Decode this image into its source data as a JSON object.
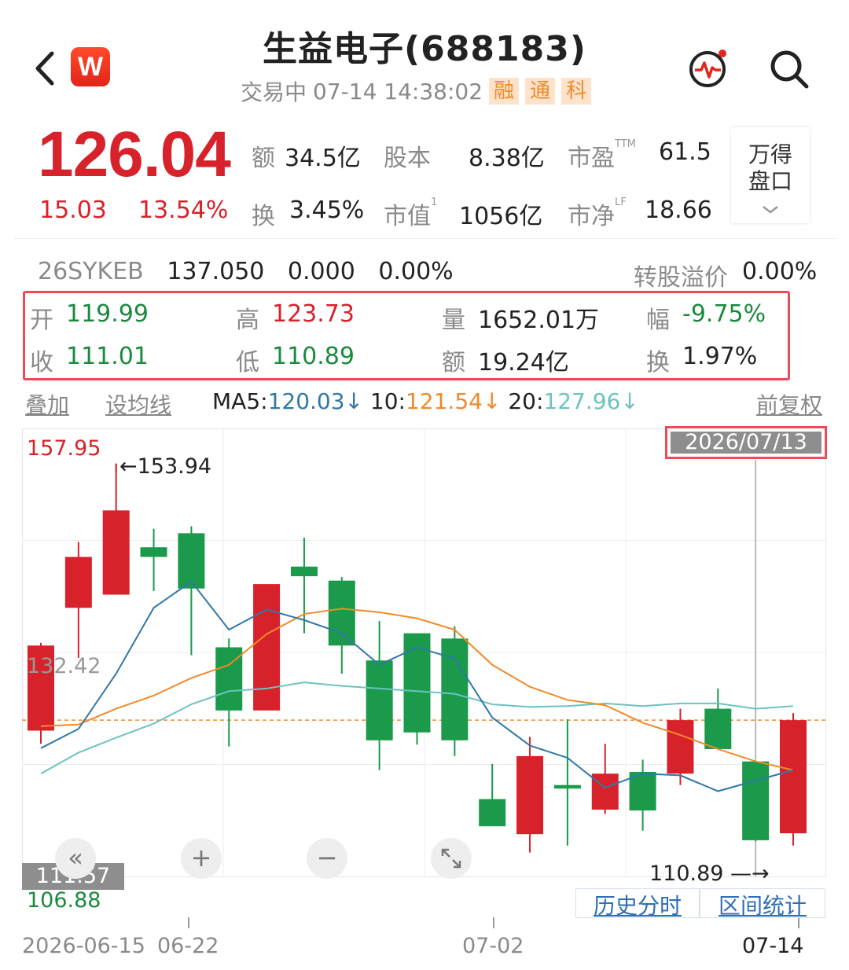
{
  "header": {
    "title": "生益电子(688183)",
    "status": "交易中",
    "datetime": "07-14 14:38:02",
    "tags": [
      "融",
      "通",
      "科"
    ],
    "logo_letter": "W"
  },
  "quote": {
    "price": "126.04",
    "change": "15.03",
    "change_pct": "13.54%",
    "amount_label": "额",
    "amount": "34.5亿",
    "equity_label": "股本",
    "equity": "8.38亿",
    "pe_label": "市盈",
    "pe_sup": "TTM",
    "pe": "61.5",
    "turnover_label": "换",
    "turnover": "3.45%",
    "mktcap_label": "市值",
    "mktcap_sup": "1",
    "mktcap": "1056亿",
    "pb_label": "市净",
    "pb_sup": "LF",
    "pb": "18.66",
    "wande_line1": "万得",
    "wande_line2": "盘口"
  },
  "bond": {
    "code": "26SYKEB",
    "price": "137.050",
    "change": "0.000",
    "pct": "0.00%",
    "premium_label": "转股溢价",
    "premium": "0.00%"
  },
  "ohlc": {
    "open_label": "开",
    "open": "119.99",
    "high_label": "高",
    "high": "123.73",
    "volume_label": "量",
    "volume": "1652.01万",
    "amp_label": "幅",
    "amp": "-9.75%",
    "close_label": "收",
    "close": "111.01",
    "low_label": "低",
    "low": "110.89",
    "amount_label": "额",
    "amount": "19.24亿",
    "turn_label": "换",
    "turn": "1.97%"
  },
  "ma_row": {
    "overlay": "叠加",
    "set_ma": "设均线",
    "ma5_label": "MA5:",
    "ma5": "120.03↓",
    "ma10_label": "10:",
    "ma10": "121.54↓",
    "ma20_label": "20:",
    "ma20": "127.96↓",
    "adjust": "前复权"
  },
  "chart_labels": {
    "ymax": "157.95",
    "ymid": "132.42",
    "ymin": "106.88",
    "cursor_price": "111.57",
    "selected_date": "2026/07/13",
    "high_marker": "←153.94",
    "low_marker": "110.89 —→",
    "history_btn": "历史分时",
    "range_btn": "区间统计",
    "x_labels": [
      "2026-06-15",
      "06-22",
      "07-02",
      "07-14"
    ]
  },
  "colors": {
    "up": "#d8222b",
    "down": "#1a9a4a",
    "ma5": "#2f78a8",
    "ma10": "#f08a2a",
    "ma20": "#6cc3c0",
    "accent": "#f04b55"
  },
  "chart_data": {
    "type": "candlestick",
    "ylim": [
      106.88,
      157.95
    ],
    "candles": [
      {
        "o": 123.5,
        "h": 133.5,
        "l": 122.0,
        "c": 133.2
      },
      {
        "o": 137.5,
        "h": 145.0,
        "l": 131.8,
        "c": 143.3
      },
      {
        "o": 139.0,
        "h": 153.94,
        "l": 139.0,
        "c": 148.6
      },
      {
        "o": 144.4,
        "h": 146.5,
        "l": 139.4,
        "c": 143.3
      },
      {
        "o": 146.0,
        "h": 146.8,
        "l": 132.1,
        "c": 139.7
      },
      {
        "o": 133.0,
        "h": 134.0,
        "l": 121.7,
        "c": 125.8
      },
      {
        "o": 125.8,
        "h": 140.0,
        "l": 125.8,
        "c": 140.2
      },
      {
        "o": 142.2,
        "h": 145.5,
        "l": 134.6,
        "c": 141.1
      },
      {
        "o": 140.6,
        "h": 141.0,
        "l": 130.0,
        "c": 133.2
      },
      {
        "o": 131.5,
        "h": 136.0,
        "l": 119.0,
        "c": 122.4
      },
      {
        "o": 134.6,
        "h": 134.6,
        "l": 121.9,
        "c": 123.3
      },
      {
        "o": 134.0,
        "h": 135.4,
        "l": 120.6,
        "c": 122.4
      },
      {
        "o": 115.7,
        "h": 119.7,
        "l": 113.8,
        "c": 112.6
      },
      {
        "o": 111.7,
        "h": 122.8,
        "l": 109.6,
        "c": 120.6
      },
      {
        "o": 117.3,
        "h": 124.8,
        "l": 110.4,
        "c": 116.9
      },
      {
        "o": 114.5,
        "h": 122.0,
        "l": 114.0,
        "c": 118.6
      },
      {
        "o": 118.8,
        "h": 120.2,
        "l": 112.1,
        "c": 114.4
      },
      {
        "o": 118.6,
        "h": 126.0,
        "l": 117.3,
        "c": 124.7
      },
      {
        "o": 126.0,
        "h": 128.3,
        "l": 121.4,
        "c": 121.4
      },
      {
        "o": 119.99,
        "h": 119.99,
        "l": 110.89,
        "c": 111.01
      },
      {
        "o": 111.8,
        "h": 125.5,
        "l": 110.4,
        "c": 124.7
      }
    ],
    "ma5": [
      121.5,
      123.7,
      130.0,
      137.5,
      140.5,
      135.0,
      137.3,
      136.1,
      134.6,
      131.0,
      133.0,
      131.7,
      125.0,
      121.8,
      120.4,
      117.0,
      118.6,
      118.4,
      116.6,
      117.8,
      119.0
    ],
    "ma10": [
      124.0,
      124.2,
      126.0,
      127.5,
      129.5,
      131.0,
      134.5,
      136.8,
      137.4,
      137.0,
      136.3,
      135.0,
      131.0,
      128.5,
      127.0,
      126.4,
      124.4,
      123.0,
      121.4,
      120.0,
      119.0
    ],
    "ma20": [
      118.6,
      121.0,
      122.7,
      124.3,
      126.5,
      128.0,
      128.3,
      129.0,
      128.6,
      128.3,
      128.0,
      127.7,
      126.5,
      126.2,
      126.3,
      126.6,
      126.3,
      126.6,
      126.6,
      126.0,
      126.3
    ]
  }
}
